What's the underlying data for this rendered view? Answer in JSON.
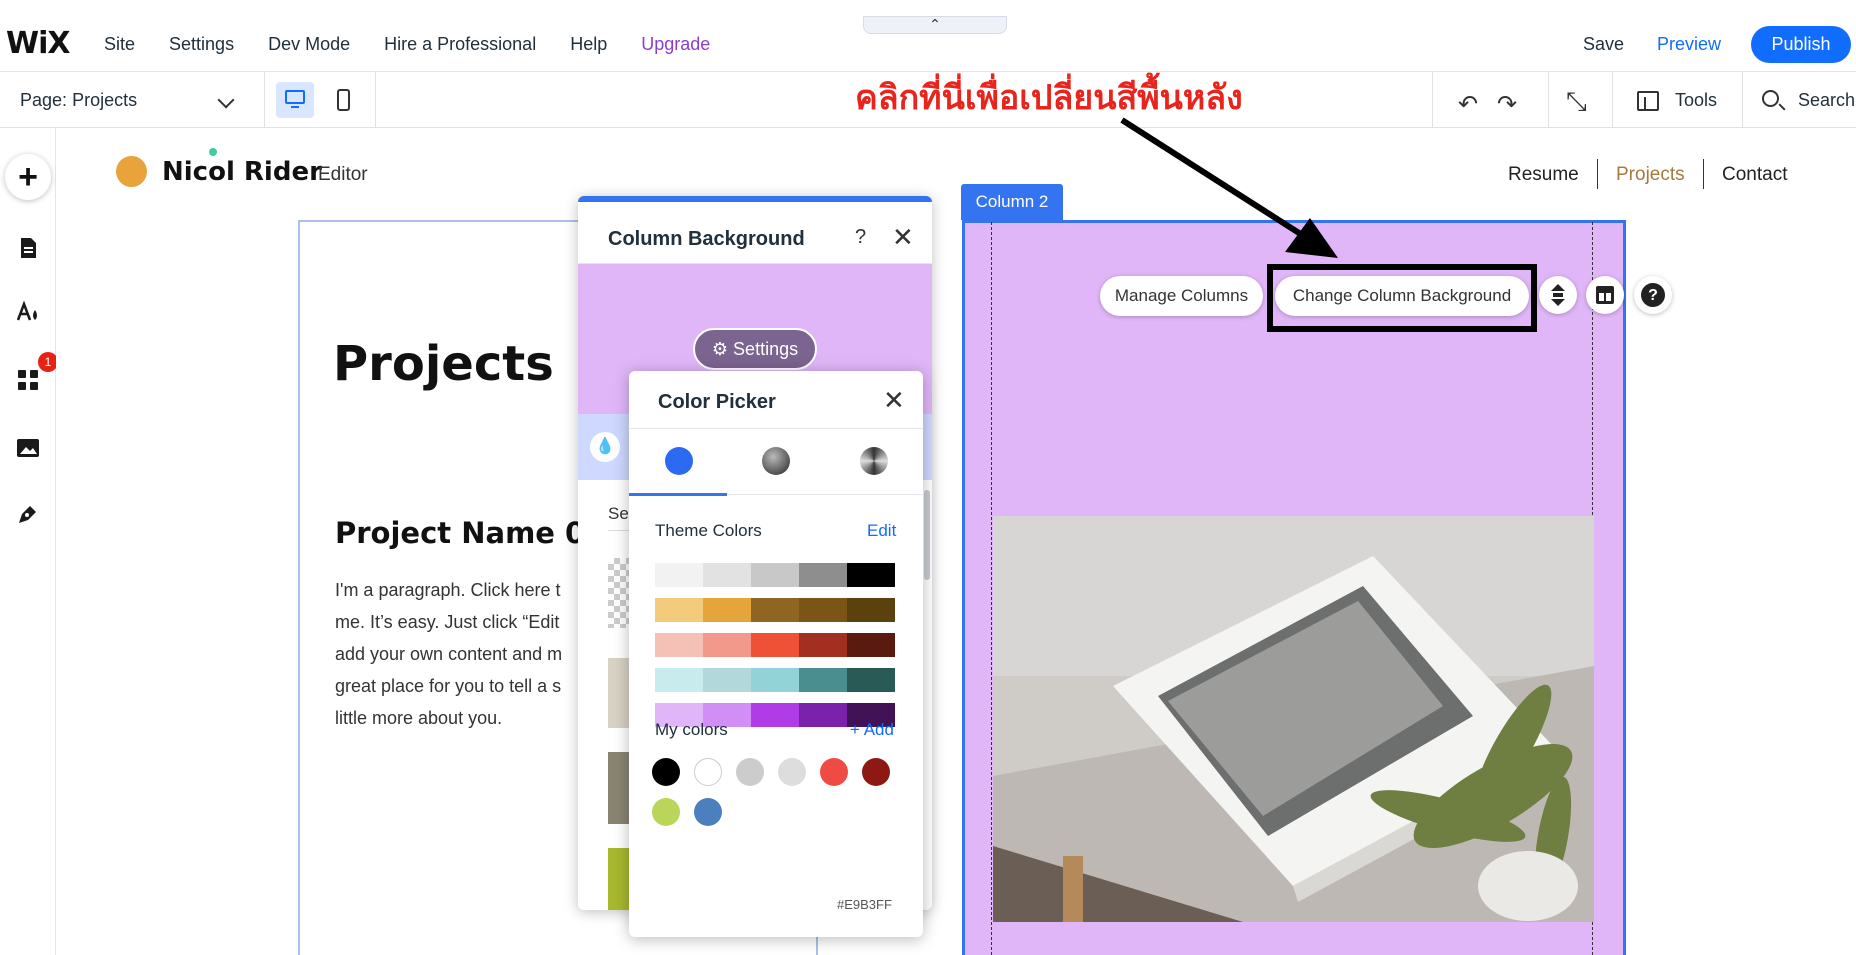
{
  "topbar": {
    "logo": "WiX",
    "menu": [
      "Site",
      "Settings",
      "Dev Mode",
      "Hire a Professional",
      "Help",
      "Upgrade"
    ],
    "collapse_glyph": "⌃",
    "save": "Save",
    "preview": "Preview",
    "publish": "Publish"
  },
  "secondbar": {
    "page_prefix": "Page:",
    "page_name": "Projects",
    "tools": "Tools",
    "search": "Search",
    "undo_glyph": "↶",
    "redo_glyph": "↷",
    "zoom_glyph": "⤡"
  },
  "annotation": {
    "text": "คลิกที่นี่เพื่อเปลี่ยนสีพื้นหลัง"
  },
  "rail": {
    "add": "+",
    "badge": "1",
    "icons": [
      "pages-icon",
      "design-icon",
      "apps-icon",
      "media-icon",
      "blog-icon"
    ]
  },
  "site": {
    "brand": "Nicol Rider",
    "brand_sub": "Editor",
    "nav": [
      "Resume",
      "Projects",
      "Contact"
    ],
    "title": "Projects",
    "project_name": "Project Name 0",
    "paragraph_lines": [
      "I'm a paragraph. Click here t",
      "me. It’s easy. Just click “Edit",
      "add your own content and m",
      "great place for you to tell a s",
      "little more about you."
    ]
  },
  "column2": {
    "tag": "Column 2",
    "manage": "Manage Columns",
    "change_bg": "Change Column Background",
    "help": "?",
    "bg_color": "#E0B6F8"
  },
  "column_bg_panel": {
    "title": "Column Background",
    "help": "?",
    "close": "✕",
    "settings": "Settings",
    "section_label": "Se"
  },
  "color_picker": {
    "title": "Color Picker",
    "close": "✕",
    "theme_colors": "Theme Colors",
    "edit": "Edit",
    "my_colors": "My colors",
    "add": "+ Add",
    "hex": "#E9B3FF",
    "theme_rows": [
      [
        "#f2f2f2",
        "#e2e2e2",
        "#c8c8c8",
        "#8e8e8e",
        "#000000"
      ],
      [
        "#f2cc7a",
        "#e6a53b",
        "#8e6521",
        "#7a5516",
        "#5b410d"
      ],
      [
        "#f5c0b5",
        "#f2998c",
        "#ee5136",
        "#a22f20",
        "#5b1a10"
      ],
      [
        "#c8ecee",
        "#b2d8dc",
        "#92d3d8",
        "#4a8e90",
        "#2a5a55"
      ],
      [
        "#e0b6f8",
        "#d18ff5",
        "#b03ce8",
        "#7b22ad",
        "#411356"
      ]
    ],
    "my_color_list": [
      "#000000",
      "#ffffff",
      "#cccccc",
      "#dddddd",
      "#ef4b44",
      "#8c1a12",
      "#b9d65a",
      "#4c7fbd"
    ]
  }
}
